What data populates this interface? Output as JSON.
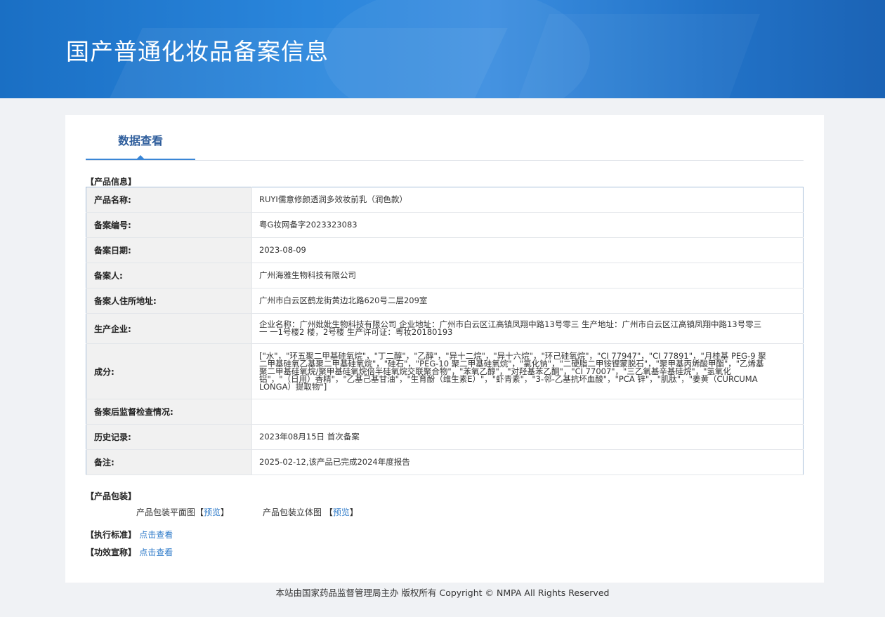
{
  "banner": {
    "title": "国产普通化妆品备案信息"
  },
  "tabs": [
    {
      "label": "数据查看"
    }
  ],
  "product_info": {
    "section_label": "【产品信息】",
    "rows": [
      {
        "key": "产品名称:",
        "value": "RUYI儒意修颜透润多效妆前乳（润色款）"
      },
      {
        "key": "备案编号:",
        "value": "粤G妆网备字2023323083"
      },
      {
        "key": "备案日期:",
        "value": "2023-08-09"
      },
      {
        "key": "备案人:",
        "value": "广州海雅生物科技有限公司"
      },
      {
        "key": "备案人住所地址:",
        "value": "广州市白云区鹤龙街黄边北路620号二层209室"
      },
      {
        "key": "生产企业:",
        "value": "企业名称：广州妣妣生物科技有限公司 企业地址：广州市白云区江高镇凤翔中路13号零三 生产地址：广州市白云区江高镇凤翔中路13号零三一 一1号楼2 楼，2号楼 生产许可证：粤妆20180193"
      },
      {
        "key": "成分:",
        "value": "[\"水\"，\"环五聚二甲基硅氧烷\"，\"丁二醇\"，\"乙醇\"，\"异十二烷\"，\"异十六烷\"，\"环己硅氧烷\"，\"CI 77947\"，\"CI 77891\"，\"月桂基 PEG-9 聚二甲基硅氧乙基聚二甲基硅氧烷\"，\"硅石\"，\"PEG-10 聚二甲基硅氧烷\"，\"氯化钠\"，\"二硬脂二甲铵锂蒙脱石\"，\"聚甲基丙烯酸甲酯\"，\"乙烯基聚二甲基硅氧烷/聚甲基硅氧烷倍半硅氧烷交联聚合物\"，\"苯氧乙醇\"，\"对羟基苯乙酮\"，\"CI 77007\"，\"三乙氧基辛基硅烷\"，\"氢氧化铝\"，\"（日用）香精\"，\"乙基己基甘油\"，\"生育酚（维生素E）\"，\"虾青素\"，\"3-邻-乙基抗坏血酸\"，\"PCA 锌\"，\"肌肽\"，\"姜黄（CURCUMA LONGA）提取物\"]"
      },
      {
        "key": "备案后监督检查情况:",
        "value": ""
      },
      {
        "key": "历史记录:",
        "value": "2023年08月15日 首次备案"
      },
      {
        "key": "备注:",
        "value": "2025-02-12,该产品已完成2024年度报告"
      }
    ]
  },
  "packaging": {
    "section_label": "【产品包装】",
    "flat_label": "产品包装平面图",
    "flat_bracket_open": "【",
    "flat_link": "预览",
    "flat_bracket_close": "】",
    "stereo_label": "产品包装立体图",
    "stereo_bracket_open": "【",
    "stereo_link": "预览",
    "stereo_bracket_close": "】"
  },
  "standard": {
    "label": "【执行标准】",
    "link": "点击查看"
  },
  "efficacy": {
    "label": "【功效宣称】",
    "link": "点击查看"
  },
  "footer": {
    "text": "本站由国家药品监督管理局主办 版权所有 Copyright © NMPA All Rights Reserved"
  }
}
